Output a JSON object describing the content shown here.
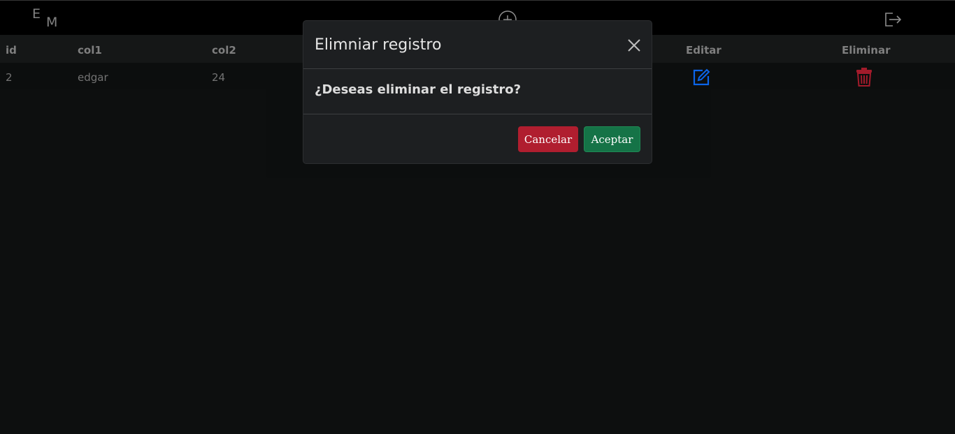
{
  "header": {
    "logo_letters": [
      "E",
      "M"
    ],
    "add_icon": "plus-circle-icon",
    "logout_icon": "logout-icon"
  },
  "table": {
    "columns": [
      "id",
      "col1",
      "col2",
      "Editar",
      "Eliminar"
    ],
    "rows": [
      {
        "id": "2",
        "col1": "edgar",
        "col2": "24",
        "edit_icon": "edit-icon",
        "delete_icon": "trash-icon"
      }
    ]
  },
  "modal": {
    "title": "Elimniar registro",
    "message": "¿Deseas eliminar el registro?",
    "cancel_label": "Cancelar",
    "accept_label": "Aceptar",
    "close_icon": "close-icon"
  },
  "colors": {
    "background": "#0e1010",
    "header_bg": "#000000",
    "modal_bg": "#1d1f21",
    "cancel": "#b01e2f",
    "accept": "#157347",
    "edit_icon": "#0d6efd",
    "delete_icon": "#b01e2f"
  }
}
